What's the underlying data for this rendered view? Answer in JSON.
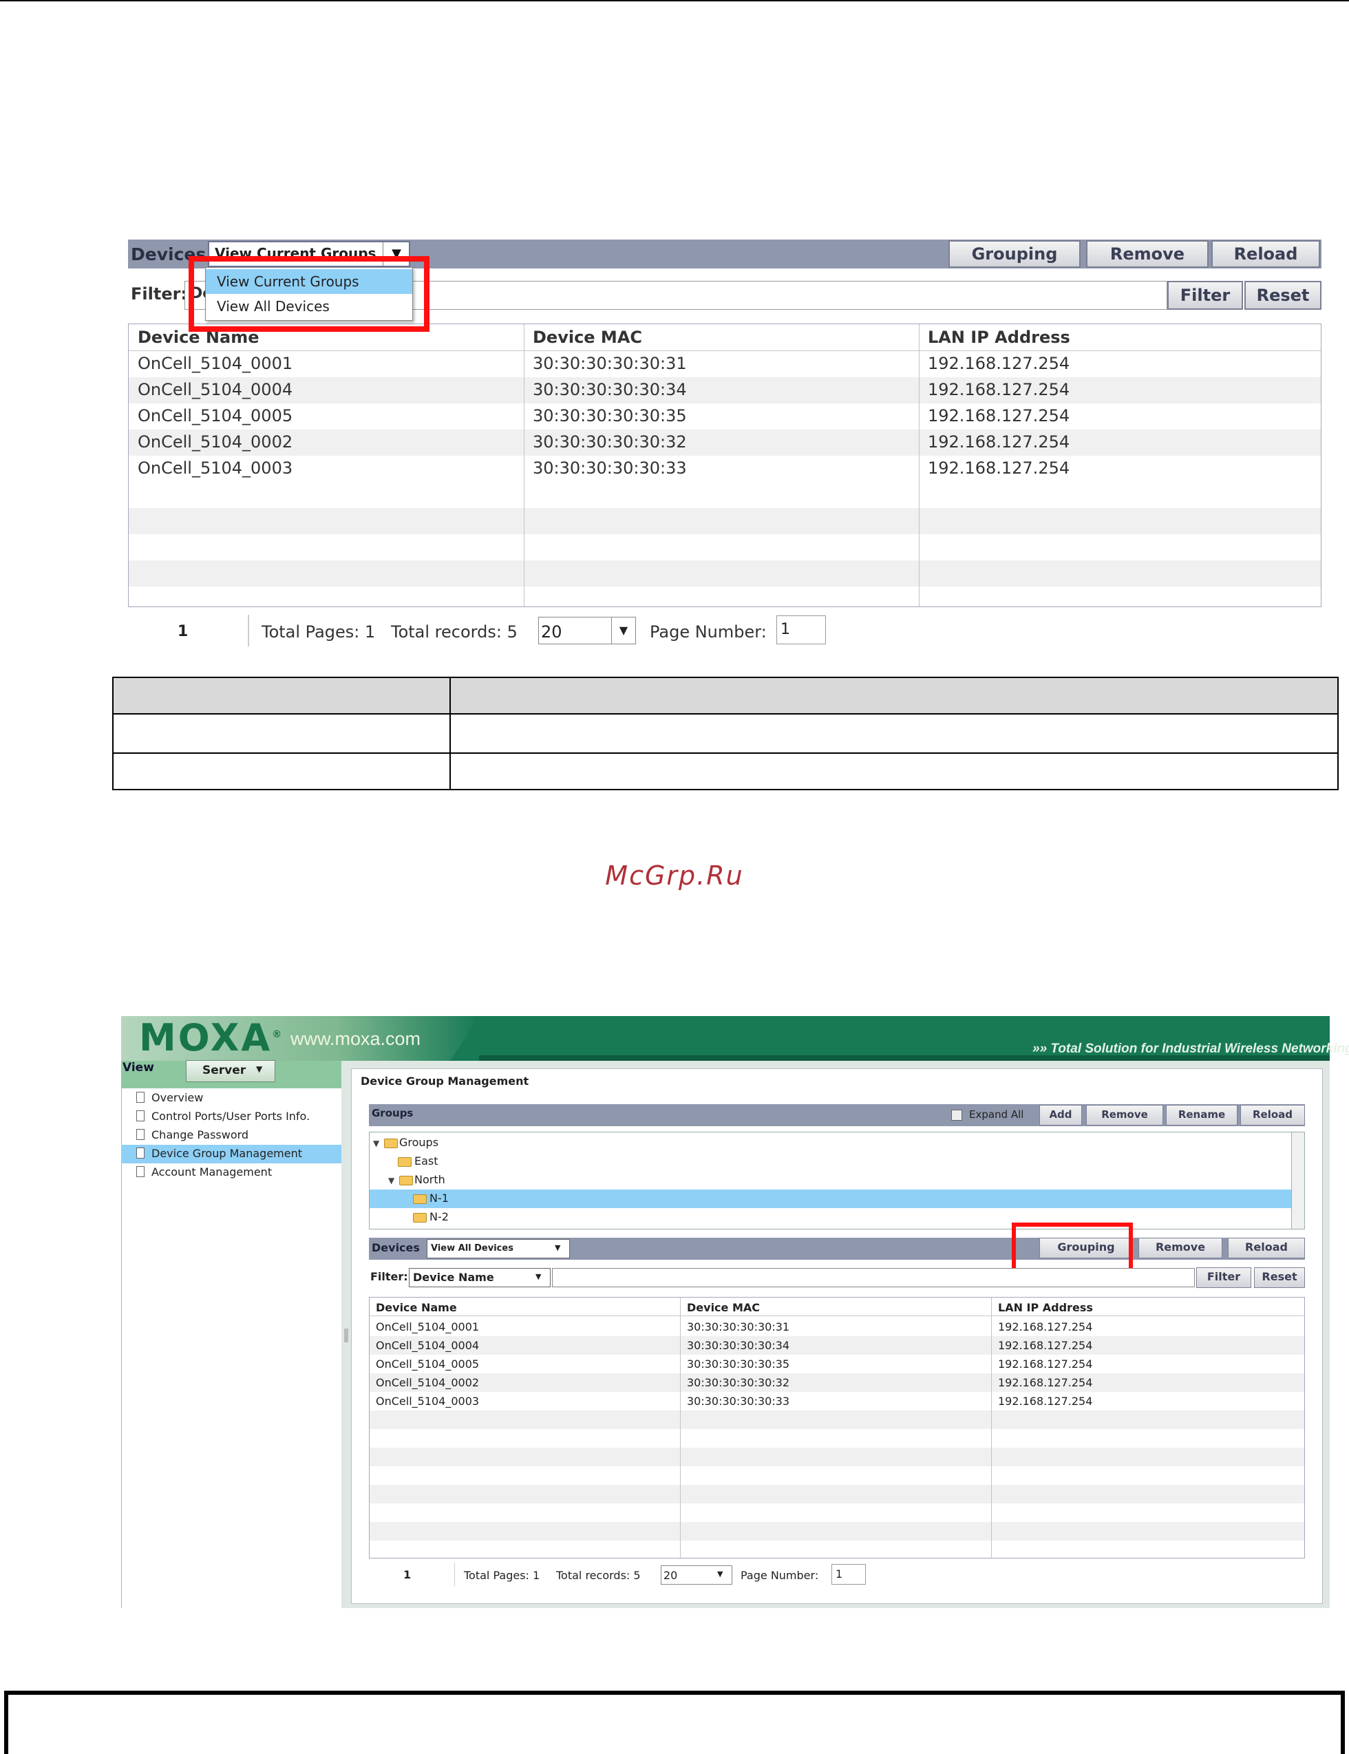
{
  "watermark": "McGrp.Ru",
  "section1": {
    "toolbar_label": "Devices",
    "view_select_value": "View Current Groups",
    "buttons": {
      "grouping": "Grouping",
      "remove": "Remove",
      "reload": "Reload"
    },
    "filter_label": "Filter:",
    "filter_select_stub": "De",
    "filter_button": "Filter",
    "reset_button": "Reset",
    "dropdown_options": [
      "View Current Groups",
      "View All Devices"
    ],
    "dropdown_selected": "View Current Groups",
    "columns": [
      "Device Name",
      "Device MAC",
      "LAN IP Address"
    ],
    "rows": [
      [
        "OnCell_5104_0001",
        "30:30:30:30:30:31",
        "192.168.127.254"
      ],
      [
        "OnCell_5104_0004",
        "30:30:30:30:30:34",
        "192.168.127.254"
      ],
      [
        "OnCell_5104_0005",
        "30:30:30:30:30:35",
        "192.168.127.254"
      ],
      [
        "OnCell_5104_0002",
        "30:30:30:30:30:32",
        "192.168.127.254"
      ],
      [
        "OnCell_5104_0003",
        "30:30:30:30:30:33",
        "192.168.127.254"
      ]
    ],
    "pager": {
      "current_page": "1",
      "total_pages": "Total Pages: 1",
      "total_records": "Total records: 5",
      "page_size": "20",
      "page_number_label": "Page Number:",
      "page_number_value": "1"
    },
    "highlight_color": "#ff1010"
  },
  "section2": {
    "logo": "MOXA",
    "logo_mark": "®",
    "url": "www.moxa.com",
    "tagline": "»» Total Solution for Industrial Wireless Networking",
    "view_label": "View",
    "server_button": "Server",
    "sidebar_items": [
      "Overview",
      "Control Ports/User Ports Info.",
      "Change Password",
      "Device Group Management",
      "Account Management"
    ],
    "sidebar_selected": "Device Group Management",
    "panel_title": "Device Group Management",
    "groups": {
      "label": "Groups",
      "expand_all": "Expand All",
      "buttons": {
        "add": "Add",
        "remove": "Remove",
        "rename": "Rename",
        "reload": "Reload"
      },
      "tree": [
        {
          "label": "Groups",
          "level": 0,
          "expanded": true
        },
        {
          "label": "East",
          "level": 1
        },
        {
          "label": "North",
          "level": 1,
          "expanded": true
        },
        {
          "label": "N-1",
          "level": 2,
          "selected": true
        },
        {
          "label": "N-2",
          "level": 2
        }
      ]
    },
    "devices": {
      "label": "Devices",
      "view_select_value": "View All Devices",
      "buttons": {
        "grouping": "Grouping",
        "remove": "Remove",
        "reload": "Reload"
      },
      "filter_label": "Filter:",
      "filter_field": "Device Name",
      "filter_button": "Filter",
      "reset_button": "Reset",
      "columns": [
        "Device Name",
        "Device MAC",
        "LAN IP Address"
      ],
      "rows": [
        [
          "OnCell_5104_0001",
          "30:30:30:30:30:31",
          "192.168.127.254"
        ],
        [
          "OnCell_5104_0004",
          "30:30:30:30:30:34",
          "192.168.127.254"
        ],
        [
          "OnCell_5104_0005",
          "30:30:30:30:30:35",
          "192.168.127.254"
        ],
        [
          "OnCell_5104_0002",
          "30:30:30:30:30:32",
          "192.168.127.254"
        ],
        [
          "OnCell_5104_0003",
          "30:30:30:30:30:33",
          "192.168.127.254"
        ]
      ],
      "pager": {
        "current_page": "1",
        "total_pages": "Total Pages: 1",
        "total_records": "Total records: 5",
        "page_size": "20",
        "page_number_label": "Page Number:",
        "page_number_value": "1"
      }
    },
    "colors": {
      "banner": "#177a55",
      "toolbar": "#8f97ad",
      "selection": "#8fd0f7"
    }
  }
}
